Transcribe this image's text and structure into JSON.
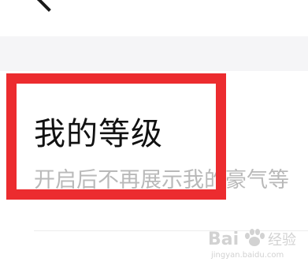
{
  "header": {
    "back_icon": "chevron-left-icon"
  },
  "setting": {
    "title": "我的等级",
    "subtitle": "开启后不再展示我的豪气等"
  },
  "watermark": {
    "brand_latin": "Bai",
    "brand_cn": "经验",
    "url": "jingyan.baidu.com"
  },
  "annotation": {
    "box_color": "#ec2c2f"
  }
}
